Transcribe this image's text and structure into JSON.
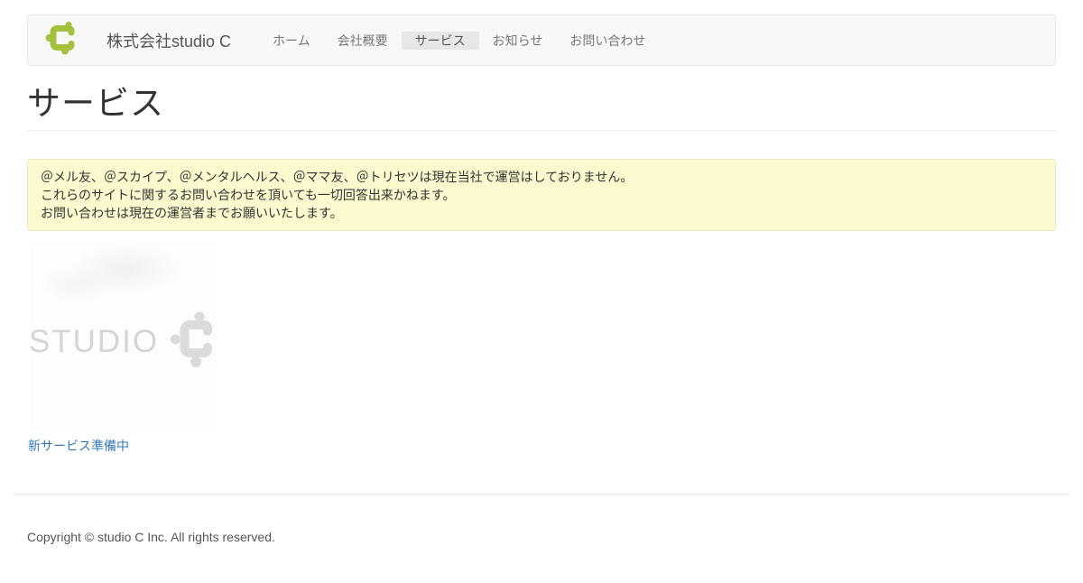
{
  "brand": {
    "name": "株式会社studio C",
    "logo_color": "#a3c13c"
  },
  "nav": {
    "items": [
      {
        "label": "ホーム",
        "active": false
      },
      {
        "label": "会社概要",
        "active": false
      },
      {
        "label": "サービス",
        "active": true
      },
      {
        "label": "お知らせ",
        "active": false
      },
      {
        "label": "お問い合わせ",
        "active": false
      }
    ],
    "active_bg": "#e7e7e7",
    "bar_bg": "#f8f8f8"
  },
  "page": {
    "title": "サービス"
  },
  "notice": {
    "bg": "#fbf9cd",
    "lines": [
      "＠メル友、＠スカイプ、＠メンタルヘルス、＠ママ友、＠トリセツは現在当社で運営はしておりません。",
      "これらのサイトに関するお問い合わせを頂いても一切回答出来かねます。",
      "お問い合わせは現在の運営者までお願いいたします。"
    ]
  },
  "content": {
    "image_text": "STUDIO",
    "image_logo": "studio-c-puzzle-mark",
    "link_label": "新サービス準備中",
    "link_color": "#337ab7"
  },
  "footer": {
    "copyright": "Copyright © studio C Inc. All rights reserved."
  }
}
